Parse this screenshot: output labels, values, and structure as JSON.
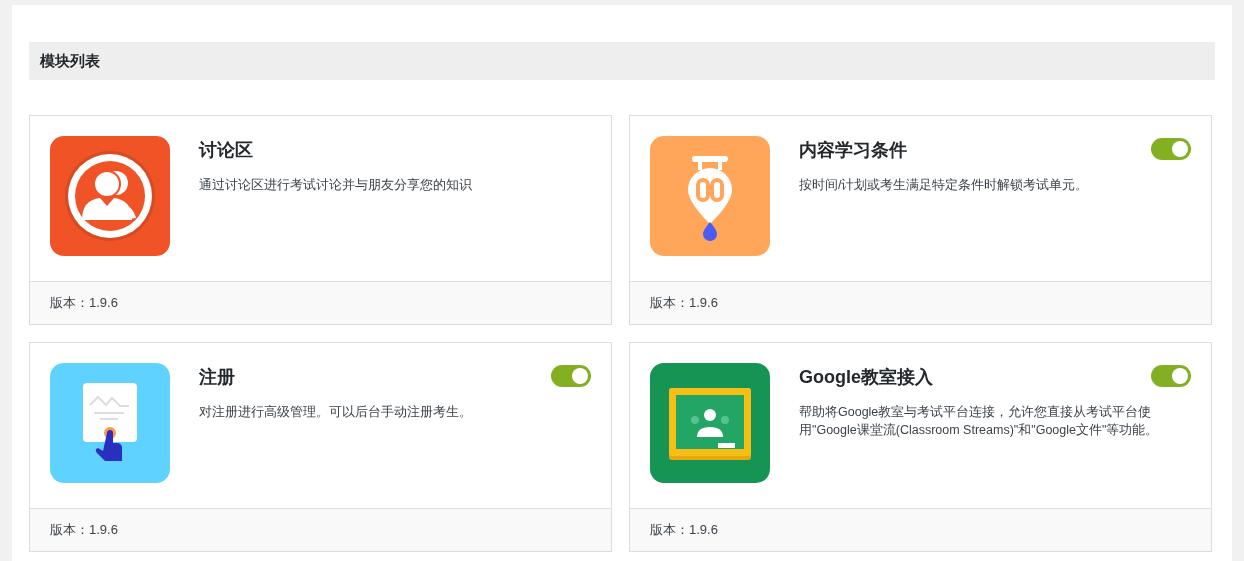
{
  "section_title": "模块列表",
  "modules": [
    {
      "title": "讨论区",
      "description": "通过讨论区进行考试讨论并与朋友分享您的知识",
      "version": "版本：1.9.6"
    },
    {
      "title": "内容学习条件",
      "description": "按时间/计划或考生满足特定条件时解锁考试单元。",
      "version": "版本：1.9.6",
      "on": true
    },
    {
      "title": "注册",
      "description": "对注册进行高级管理。可以后台手动注册考生。",
      "version": "版本：1.9.6",
      "on": true
    },
    {
      "title": "Google教室接入",
      "description": "帮助将Google教室与考试平台连接，允许您直接从考试平台使用\"Google课堂流(Classroom Streams)\"和\"Google文件\"等功能。",
      "version": "版本：1.9.6",
      "on": true
    }
  ]
}
